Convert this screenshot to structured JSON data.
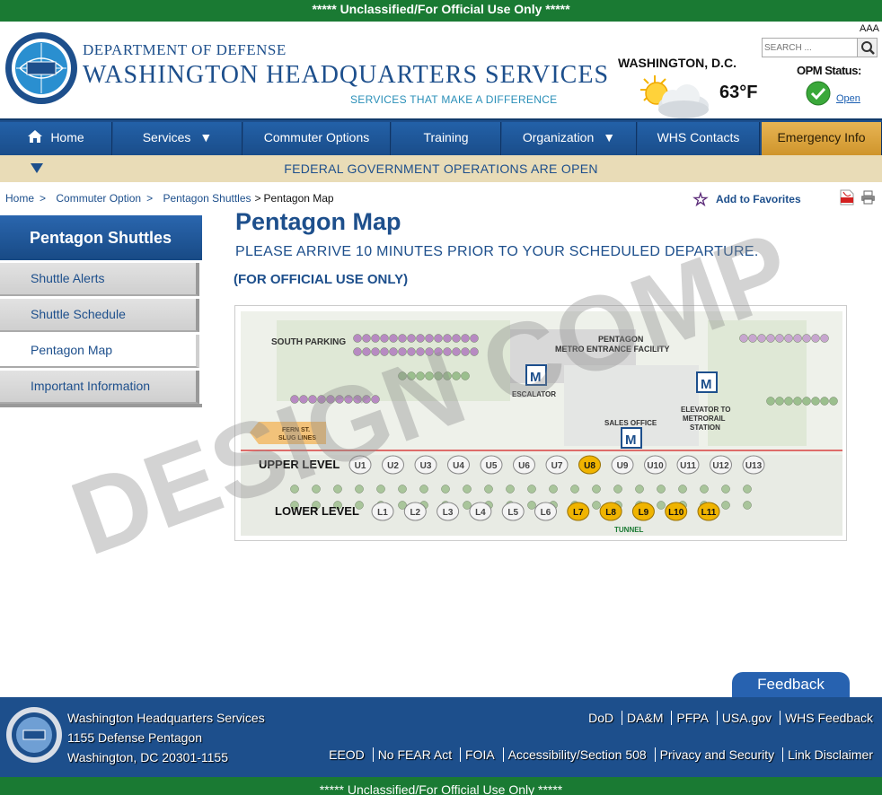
{
  "banner": {
    "top": "***** Unclassified/For Official Use Only *****",
    "bottom": "***** Unclassified/For Official Use Only *****"
  },
  "header": {
    "dept": "DEPARTMENT OF DEFENSE",
    "title": "WASHINGTON HEADQUARTERS SERVICES",
    "tagline": "SERVICES THAT MAKE A DIFFERENCE",
    "font_size_label": "AAA",
    "search_placeholder": "SEARCH ...",
    "weather": {
      "city": "WASHINGTON, D.C.",
      "temp": "63°F",
      "icon": "partly-cloudy-icon"
    },
    "opm": {
      "label": "OPM Status:",
      "status": "Open"
    }
  },
  "nav": {
    "items": [
      {
        "label": "Home",
        "icon": "home-icon"
      },
      {
        "label": "Services"
      },
      {
        "label": "Commuter Options"
      },
      {
        "label": "Training"
      },
      {
        "label": "Organization"
      },
      {
        "label": "WHS Contacts"
      },
      {
        "label": "Emergency Info"
      }
    ]
  },
  "status_bar": {
    "text": "FEDERAL GOVERNMENT OPERATIONS ARE OPEN"
  },
  "breadcrumb": {
    "items": [
      "Home",
      "Commuter Option",
      "Pentagon Shuttles"
    ],
    "current": "Pentagon Map"
  },
  "favorites": {
    "label": "Add to Favorites"
  },
  "sidebar": {
    "heading": "Pentagon Shuttles",
    "items": [
      {
        "label": "Shuttle Alerts"
      },
      {
        "label": "Shuttle Schedule"
      },
      {
        "label": "Pentagon Map"
      },
      {
        "label": "Important Information"
      }
    ]
  },
  "content": {
    "title": "Pentagon Map",
    "notice": "PLEASE ARRIVE 10 MINUTES PRIOR TO YOUR SCHEDULED DEPARTURE.",
    "fouo": "(FOR OFFICIAL USE ONLY)"
  },
  "map": {
    "labels": {
      "south_parking": "SOUTH PARKING",
      "metro_facility_1": "PENTAGON",
      "metro_facility_2": "METRO ENTRANCE FACILITY",
      "escalator": "ESCALATOR",
      "elevator_1": "ELEVATOR TO",
      "elevator_2": "METRORAIL",
      "elevator_3": "STATION",
      "sales_office": "SALES OFFICE",
      "fern_1": "FERN ST.",
      "fern_2": "SLUG LINES",
      "upper_level": "UPPER LEVEL",
      "lower_level": "LOWER LEVEL",
      "tunnel": "TUNNEL"
    },
    "upper_bays": [
      "U1",
      "U2",
      "U3",
      "U4",
      "U5",
      "U6",
      "U7",
      "U8",
      "U9",
      "U10",
      "U11",
      "U12",
      "U13"
    ],
    "upper_highlight": [
      "U8"
    ],
    "lower_bays": [
      "L1",
      "L2",
      "L3",
      "L4",
      "L5",
      "L6",
      "L7",
      "L8",
      "L9",
      "L10",
      "L11"
    ],
    "lower_highlight": [
      "L7",
      "L8",
      "L9",
      "L10",
      "L11"
    ]
  },
  "watermark": "DESIGN COMP",
  "feedback": {
    "label": "Feedback"
  },
  "footer": {
    "address": [
      "Washington Headquarters Services",
      "1155 Defense Pentagon",
      "Washington, DC 20301-1155"
    ],
    "links_row1": [
      "DoD",
      "DA&M",
      "PFPA",
      "USA.gov",
      "WHS Feedback"
    ],
    "links_row2": [
      "EEOD",
      "No FEAR Act",
      "FOIA",
      "Accessibility/Section 508",
      "Privacy and Security",
      "Link Disclaimer"
    ]
  },
  "colors": {
    "brand_blue": "#1d4f8c",
    "banner_green": "#1a7a33",
    "emergency_gold": "#d9a23b",
    "status_tan": "#e9dcb7",
    "bay_highlight": "#f0b400"
  }
}
